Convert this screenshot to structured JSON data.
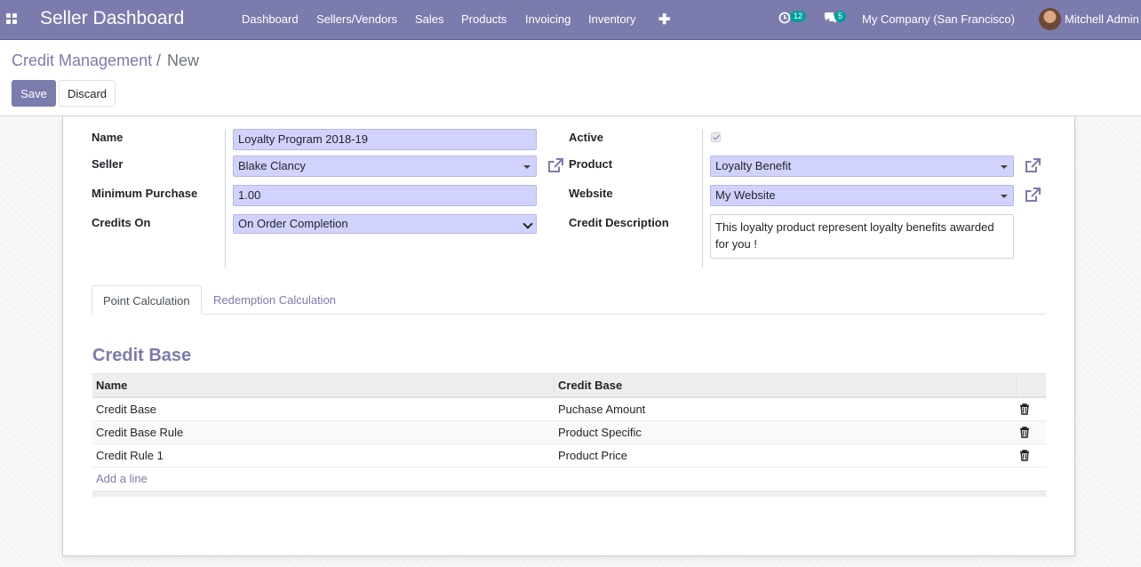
{
  "navbar": {
    "brand": "Seller Dashboard",
    "menu": [
      "Dashboard",
      "Sellers/Vendors",
      "Sales",
      "Products",
      "Invoicing",
      "Inventory"
    ],
    "activity_count": "12",
    "messages_count": "5",
    "company": "My Company (San Francisco)",
    "user": "Mitchell Admin"
  },
  "breadcrumb": {
    "parent": "Credit Management",
    "separator": "/",
    "current": "New"
  },
  "buttons": {
    "save": "Save",
    "discard": "Discard"
  },
  "form": {
    "left": {
      "name_label": "Name",
      "name_value": "Loyalty Program 2018-19",
      "seller_label": "Seller",
      "seller_value": "Blake Clancy",
      "min_purchase_label": "Minimum Purchase",
      "min_purchase_value": "1.00",
      "credits_on_label": "Credits On",
      "credits_on_value": "On Order Completion"
    },
    "right": {
      "active_label": "Active",
      "active_checked": true,
      "product_label": "Product",
      "product_value": "Loyalty Benefit",
      "website_label": "Website",
      "website_value": "My Website",
      "description_label": "Credit Description",
      "description_value": "This loyalty product represent loyalty benefits awarded for you !"
    }
  },
  "tabs": [
    "Point Calculation",
    "Redemption Calculation"
  ],
  "credit_base": {
    "title": "Credit Base",
    "columns": [
      "Name",
      "Credit Base"
    ],
    "rows": [
      {
        "name": "Credit Base",
        "base": "Puchase Amount"
      },
      {
        "name": "Credit Base Rule",
        "base": "Product Specific"
      },
      {
        "name": "Credit Rule 1",
        "base": "Product Price"
      }
    ],
    "add_line": "Add a line"
  },
  "colors": {
    "brand": "#7c7bad",
    "required_field": "#d2d2ff",
    "badge": "#00a09d"
  },
  "icons": {
    "apps": "apps-grid-icon",
    "new": "plus-icon",
    "activity": "clock-icon",
    "messages": "chat-icon",
    "external": "external-link-icon",
    "delete": "trash-icon"
  }
}
